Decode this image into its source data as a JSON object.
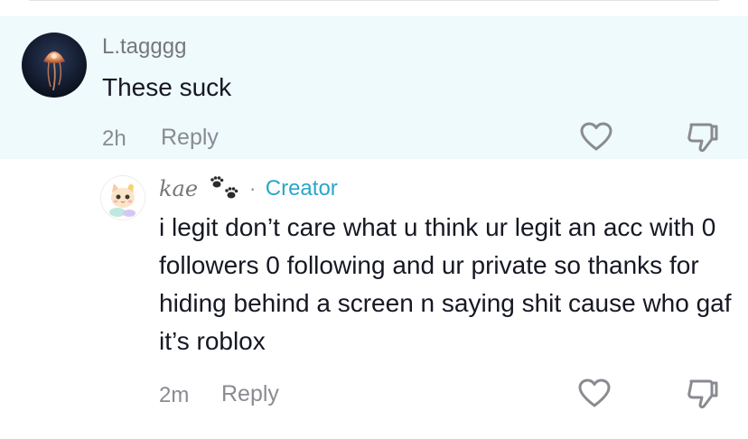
{
  "top_comment": {
    "username": "L.tagggg",
    "text": "These suck",
    "timestamp": "2h",
    "reply_label": "Reply",
    "highlight_color": "#eefafc",
    "avatar_icon": "jellyfish-avatar",
    "like_icon": "heart-outline-icon",
    "dislike_icon": "thumbs-down-outline-icon"
  },
  "reply_comment": {
    "username": "kae",
    "username_decoration": "paw-prints-icon",
    "separator": "·",
    "badge": "Creator",
    "badge_color": "#2aa7c9",
    "text": "i legit don’t care what u think ur legit an acc with 0 followers 0 following and ur private so thanks for hiding behind a screen n saying shit cause who gaf it’s roblox",
    "timestamp": "2m",
    "reply_label": "Reply",
    "avatar_icon": "cat-avatar",
    "like_icon": "heart-outline-icon",
    "dislike_icon": "thumbs-down-outline-icon"
  }
}
